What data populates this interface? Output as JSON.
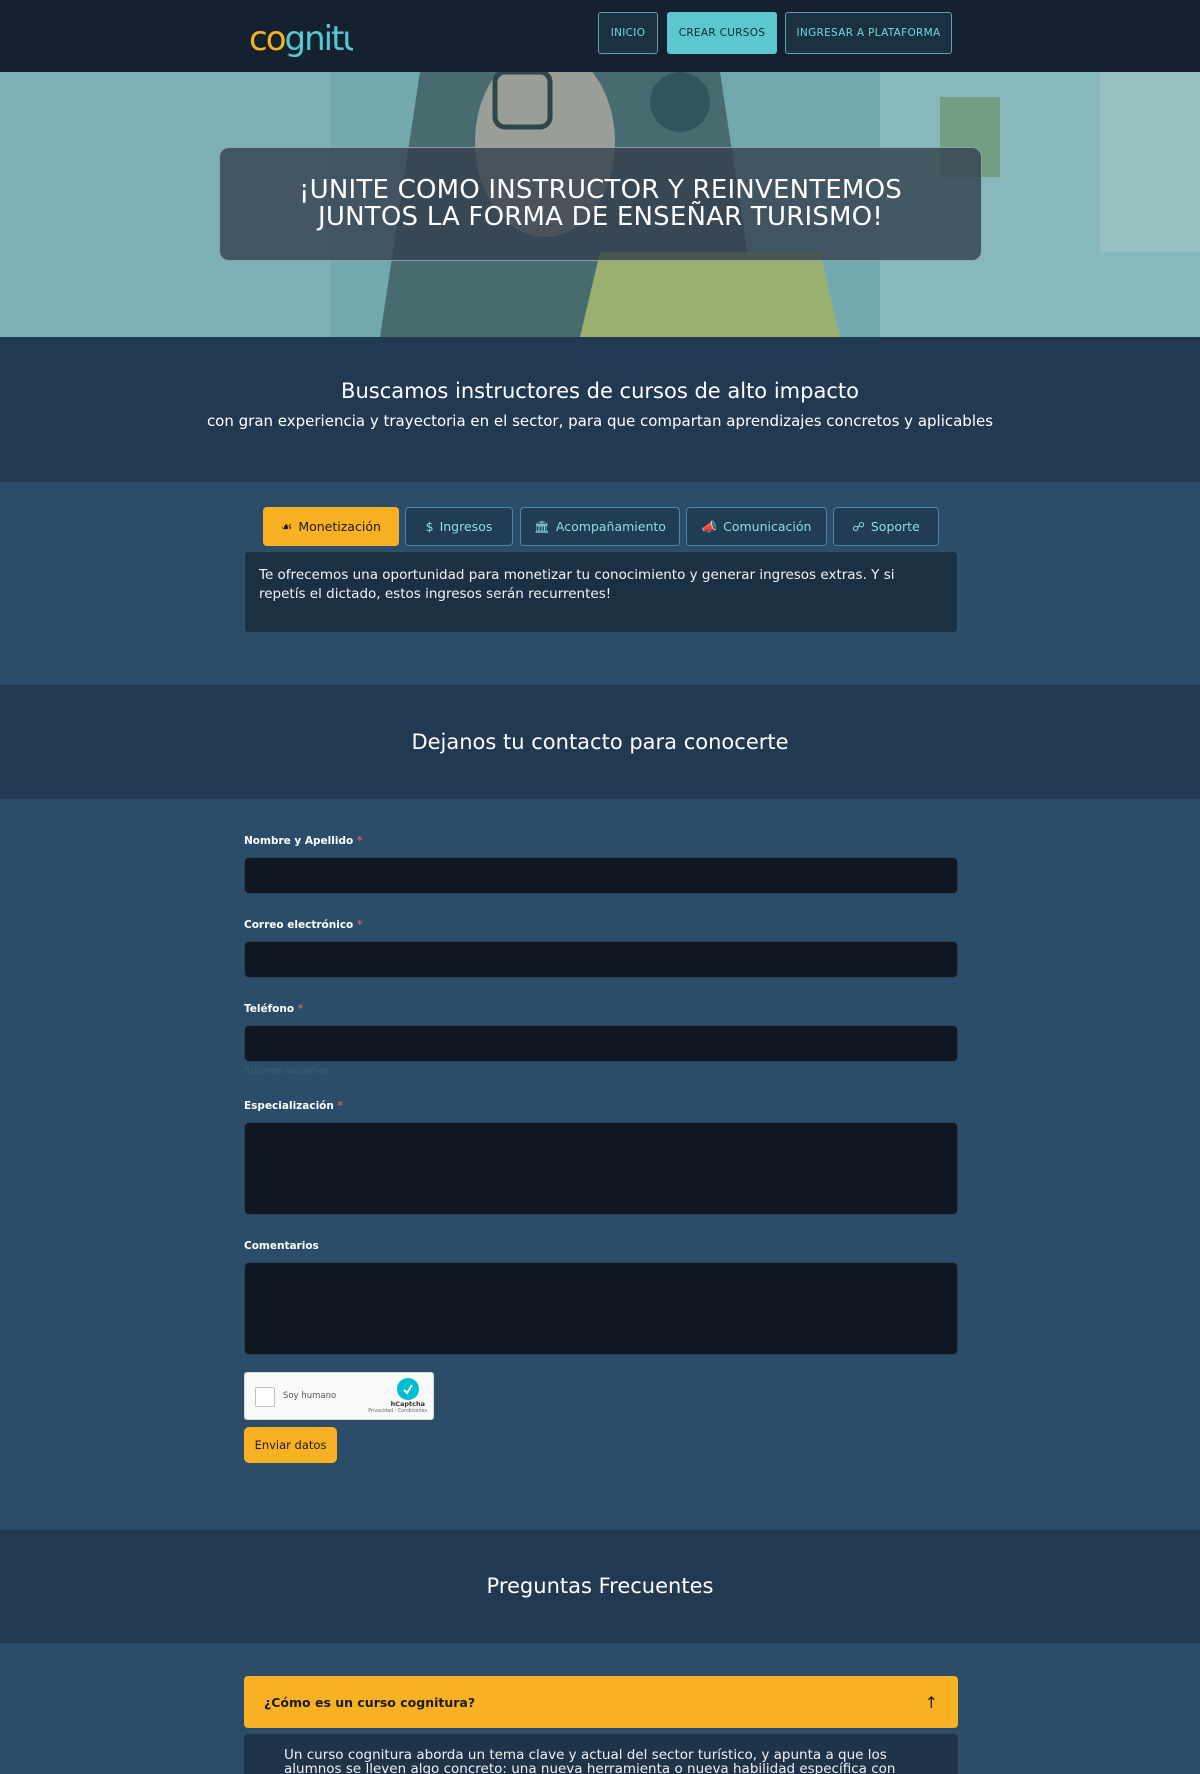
{
  "header": {
    "logo_text": "cognitura",
    "nav": [
      {
        "label": "INICIO"
      },
      {
        "label": "CREAR CURSOS",
        "active": true
      },
      {
        "label": "INGRESAR A PLATAFORMA"
      }
    ]
  },
  "hero": {
    "title": "¡UNITE COMO INSTRUCTOR Y REINVENTEMOS JUNTOS LA FORMA DE ENSEÑAR TURISMO!"
  },
  "intro": {
    "title": "Buscamos instructores de cursos de alto impacto",
    "subtitle": "con gran experiencia y trayectoria en el sector, para que compartan aprendizajes concretos y aplicables"
  },
  "tabs": {
    "items": [
      {
        "label": "Monetización",
        "icon": "money-bag-icon",
        "active": true
      },
      {
        "label": "Ingresos",
        "icon": "dollar-icon"
      },
      {
        "label": "Acompañamiento",
        "icon": "bank-icon"
      },
      {
        "label": "Comunicación",
        "icon": "megaphone-icon"
      },
      {
        "label": "Soporte",
        "icon": "coins-icon"
      }
    ],
    "panel_text": "Te ofrecemos una oportunidad para monetizar tu conocimiento y generar ingresos extras. Y si repetís el dictado, estos ingresos serán recurrentes!"
  },
  "contact": {
    "title": "Dejanos tu contacto para conocerte",
    "fields": {
      "name_label": "Nombre y Apellido",
      "email_label": "Correo electrónico",
      "phone_label": "Teléfono",
      "phone_hint": "Tu número de teléfono",
      "spec_label": "Especialización",
      "comments_label": "Comentarios",
      "required_mark": "*"
    },
    "captcha": {
      "text": "Soy humano",
      "brand": "hCaptcha",
      "links": "Privacidad - Condiciones"
    },
    "submit_label": "Enviar datos"
  },
  "faq": {
    "title": "Preguntas Frecuentes",
    "question": "¿Cómo es un curso cognitura?",
    "answer": "Un curso cognitura aborda un tema clave y actual del sector turístico, y apunta a que los alumnos se lleven algo concreto: una nueva herramienta o nueva habilidad específica con aplicación real."
  },
  "colors": {
    "accent": "#f8b122",
    "teal": "#5cc7cc",
    "background": "#2c4d69",
    "band": "#213a52",
    "header": "#142230"
  }
}
